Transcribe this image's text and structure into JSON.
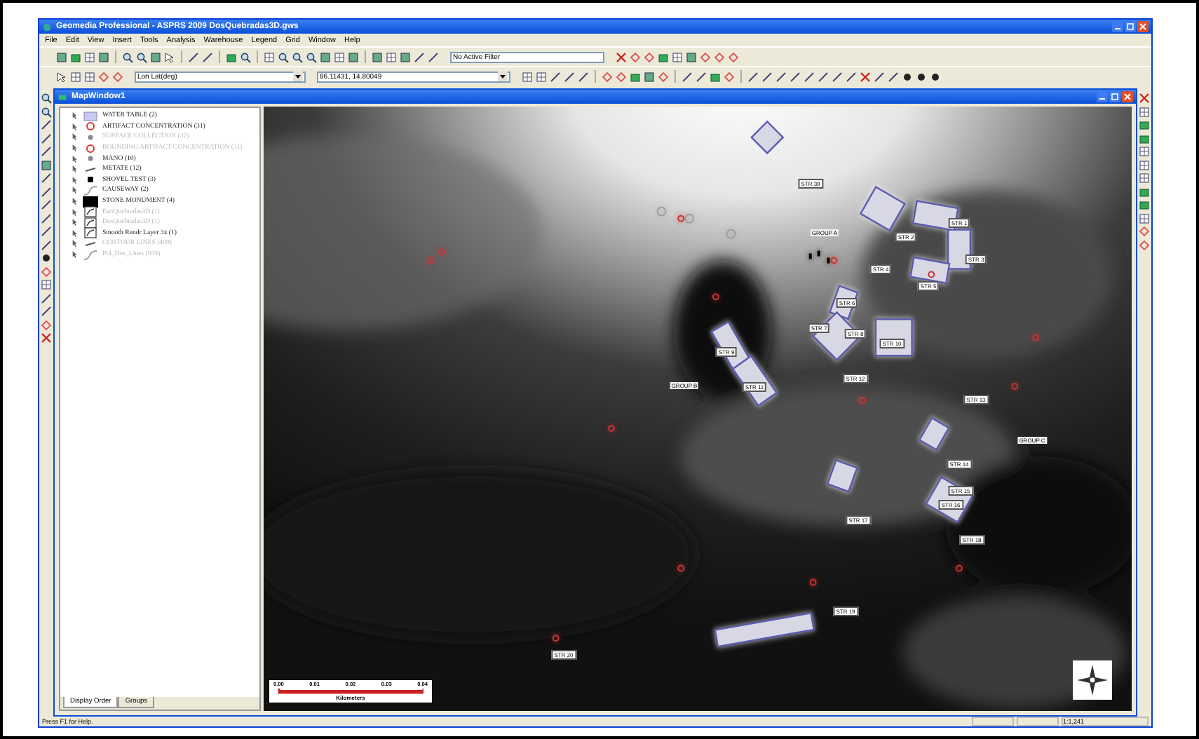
{
  "window": {
    "title": "Geomedia Professional - ASPRS 2009 DosQuebradas3D.gws"
  },
  "menu": [
    "File",
    "Edit",
    "View",
    "Insert",
    "Tools",
    "Analysis",
    "Warehouse",
    "Legend",
    "Grid",
    "Window",
    "Help"
  ],
  "toolbar": {
    "filter": "No Active Filter",
    "coordinate_system": "Lon Lat(deg)",
    "coordinates": "86.11431, 14.80049"
  },
  "map_window": {
    "title": "MapWindow1",
    "legend": {
      "items": [
        {
          "label": "WATER TABLE (2)",
          "kind": "area",
          "disabled": false
        },
        {
          "label": "ARTIFACT CONCENTRATION (31)",
          "kind": "ring",
          "disabled": false
        },
        {
          "label": "SURFACE COLLECTION (32)",
          "kind": "dot",
          "disabled": true
        },
        {
          "label": "BOUNDING ARTIFACT CONCENTRATION (31)",
          "kind": "ring",
          "disabled": true
        },
        {
          "label": "MANO (10)",
          "kind": "dot",
          "disabled": false
        },
        {
          "label": "METATE (12)",
          "kind": "line",
          "disabled": false
        },
        {
          "label": "SHOVEL TEST (3)",
          "kind": "square",
          "disabled": false
        },
        {
          "label": "CAUSEWAY (2)",
          "kind": "curve",
          "disabled": false
        },
        {
          "label": "STONE MONUMENT (4)",
          "kind": "fill",
          "disabled": false
        },
        {
          "label": "EsriQuebradas3D (1)",
          "kind": "image",
          "disabled": true
        },
        {
          "label": "DosQuebradas3D (1)",
          "kind": "image",
          "disabled": true
        },
        {
          "label": "Smooth Rendr Layer 3x (1)",
          "kind": "image",
          "disabled": false
        },
        {
          "label": "CONTOUR LINES (499)",
          "kind": "line",
          "disabled": true
        },
        {
          "label": "Pt4_Dos_Lines (939)",
          "kind": "curve",
          "disabled": true
        }
      ],
      "tabs": [
        {
          "label": "Display Order",
          "selected": true
        },
        {
          "label": "Groups",
          "selected": false
        }
      ]
    },
    "map": {
      "labels": [
        {
          "text": "STR 39",
          "kind": "structure"
        },
        {
          "text": "GROUP A",
          "kind": "group"
        },
        {
          "text": "STR 1",
          "kind": "structure"
        },
        {
          "text": "STR 2",
          "kind": "structure"
        },
        {
          "text": "STR 3",
          "kind": "structure"
        },
        {
          "text": "STR 4",
          "kind": "structure"
        },
        {
          "text": "STR 5",
          "kind": "structure"
        },
        {
          "text": "STR 6",
          "kind": "structure"
        },
        {
          "text": "STR 7",
          "kind": "structure"
        },
        {
          "text": "STR 8",
          "kind": "structure"
        },
        {
          "text": "STR 9",
          "kind": "structure"
        },
        {
          "text": "STR 10",
          "kind": "structure"
        },
        {
          "text": "GROUP B",
          "kind": "group"
        },
        {
          "text": "STR 11",
          "kind": "structure"
        },
        {
          "text": "STR 12",
          "kind": "structure"
        },
        {
          "text": "STR 13",
          "kind": "structure"
        },
        {
          "text": "GROUP C",
          "kind": "group"
        },
        {
          "text": "STR 14",
          "kind": "structure"
        },
        {
          "text": "STR 15",
          "kind": "structure"
        },
        {
          "text": "STR 16",
          "kind": "structure"
        },
        {
          "text": "STR 17",
          "kind": "structure"
        },
        {
          "text": "STR 18",
          "kind": "structure"
        },
        {
          "text": "STR 19",
          "kind": "structure"
        },
        {
          "text": "STR 20",
          "kind": "structure"
        }
      ],
      "scale_bar": {
        "ticks": [
          "0.00",
          "0.01",
          "0.02",
          "0.03",
          "0.04"
        ],
        "unit": "Kilometers"
      }
    }
  },
  "status_bar": {
    "message": "Press F1 for Help.",
    "scale": "1:1,241"
  }
}
